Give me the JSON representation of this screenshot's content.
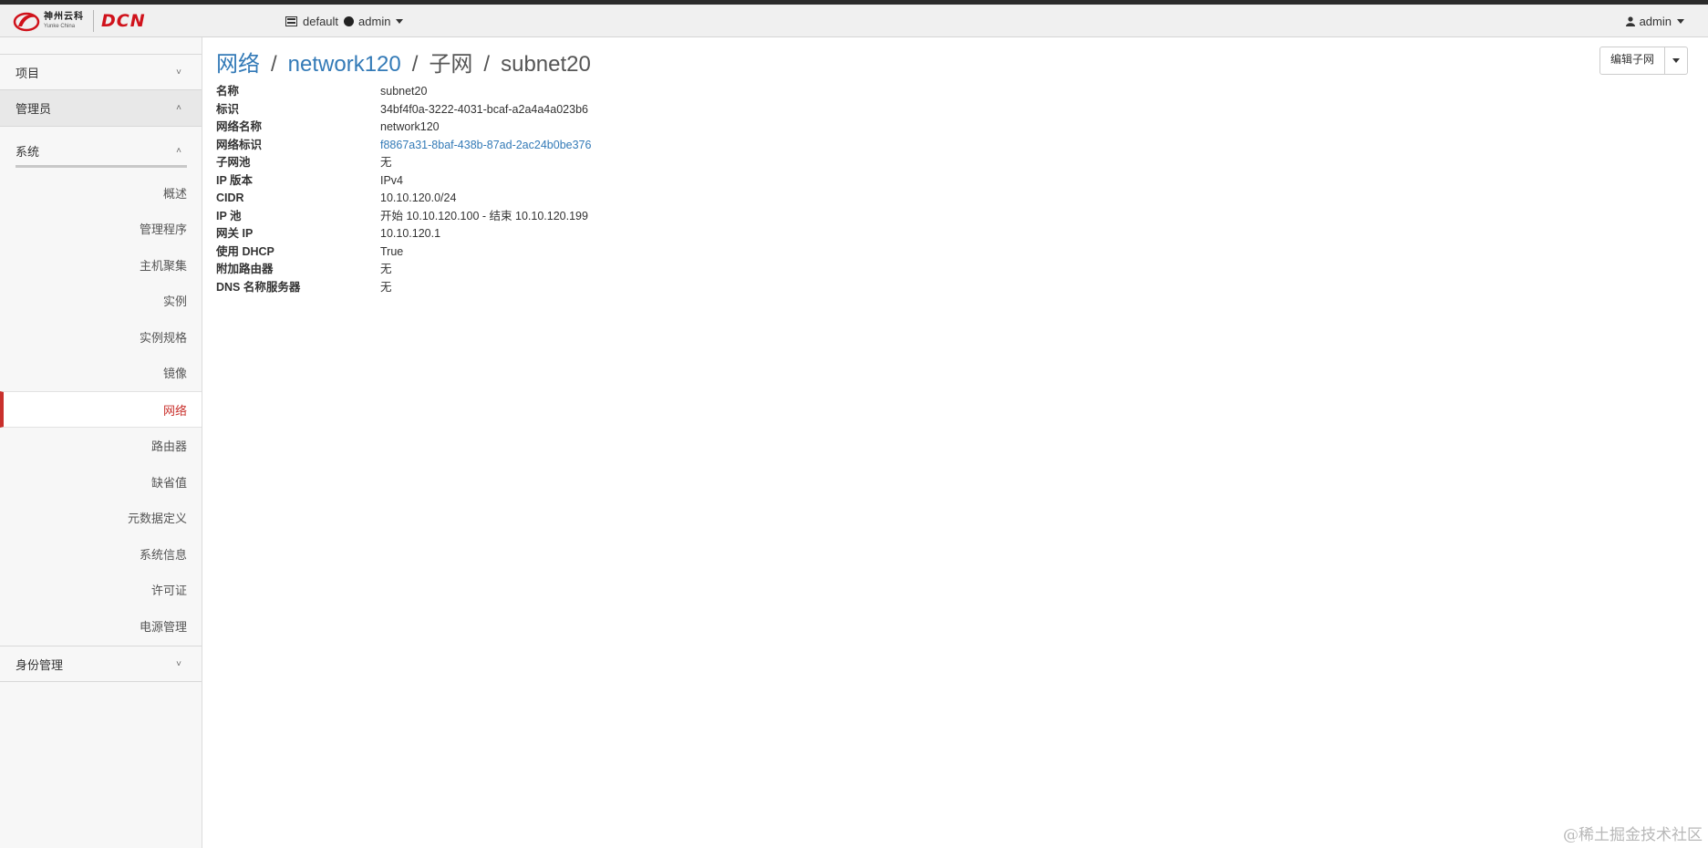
{
  "topbar": {
    "logo_cn": "神州云科",
    "logo_en": "Yunke China",
    "logo_brand": "DCN",
    "project_domain": "default",
    "project_user": "admin",
    "user": "admin"
  },
  "sidebar": {
    "project": "项目",
    "admin": "管理员",
    "system": "系统",
    "items": [
      "概述",
      "管理程序",
      "主机聚集",
      "实例",
      "实例规格",
      "镜像",
      "网络",
      "路由器",
      "缺省值",
      "元数据定义",
      "系统信息",
      "许可证",
      "电源管理"
    ],
    "active_item": "网络",
    "identity": "身份管理"
  },
  "breadcrumb": {
    "level1": "网络",
    "level2": "network120",
    "level3": "子网",
    "current": "subnet20"
  },
  "actions": {
    "edit_label": "编辑子网"
  },
  "details": [
    {
      "key": "名称",
      "value": "subnet20"
    },
    {
      "key": "标识",
      "value": "34bf4f0a-3222-4031-bcaf-a2a4a4a023b6"
    },
    {
      "key": "网络名称",
      "value": "network120"
    },
    {
      "key": "网络标识",
      "value": "f8867a31-8baf-438b-87ad-2ac24b0be376",
      "link": true
    },
    {
      "key": "子网池",
      "value": "无"
    },
    {
      "key": "IP 版本",
      "value": "IPv4"
    },
    {
      "key": "CIDR",
      "value": "10.10.120.0/24"
    },
    {
      "key": "IP 池",
      "value": "开始 10.10.120.100 - 结束 10.10.120.199"
    },
    {
      "key": "网关 IP",
      "value": "10.10.120.1"
    },
    {
      "key": "使用 DHCP",
      "value": "True"
    },
    {
      "key": "附加路由器",
      "value": "无"
    },
    {
      "key": "DNS 名称服务器",
      "value": "无"
    }
  ],
  "watermark": "@稀土掘金技术社区",
  "colors": {
    "brand_red": "#d0121b",
    "active_red": "#c9302c",
    "link_blue": "#337ab7"
  },
  "icons": {
    "project": "server-icon",
    "user": "user-icon",
    "expand": "chevron-down-icon",
    "collapse": "chevron-up-icon"
  }
}
